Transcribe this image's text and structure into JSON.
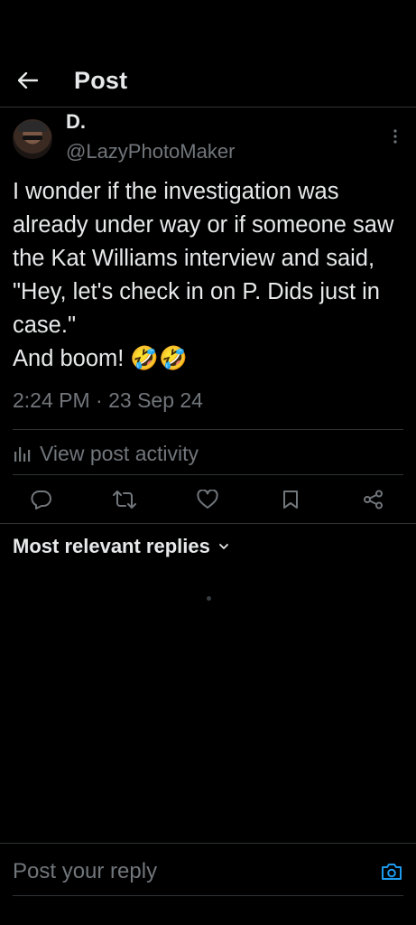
{
  "header": {
    "title": "Post",
    "back_icon": "arrow-left-icon"
  },
  "author": {
    "name": "D.",
    "handle": "@LazyPhotoMaker"
  },
  "post": {
    "text": "I wonder if the investigation was already under way or if someone saw the Kat Williams interview and said, \"Hey, let's check in on P. Dids just in case.\"\nAnd boom!  🤣🤣",
    "timestamp": "2:24 PM · 23 Sep 24"
  },
  "activity": {
    "label": "View post activity"
  },
  "actions": [
    "reply-icon",
    "repost-icon",
    "like-icon",
    "bookmark-icon",
    "share-icon"
  ],
  "replies": {
    "sort_label": "Most relevant replies"
  },
  "reply_box": {
    "placeholder": "Post your reply"
  },
  "colors": {
    "background": "#000000",
    "text": "#e7e9ea",
    "muted": "#71767b",
    "divider": "#2f3336",
    "accent": "#1d9bf0"
  }
}
